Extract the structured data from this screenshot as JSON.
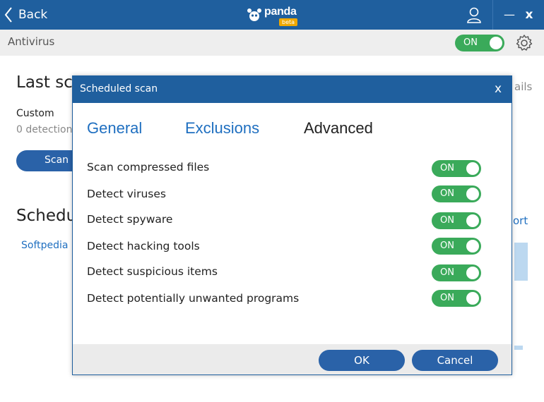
{
  "titlebar": {
    "back_label": "Back",
    "logo_text": "panda",
    "logo_badge": "beta",
    "minimize_label": "—",
    "close_label": "x"
  },
  "antivirus_bar": {
    "title": "Antivirus",
    "toggle_label": "ON"
  },
  "background": {
    "last_scan_title": "Last sca",
    "scan_type": "Custom",
    "detections": "0 detections",
    "scan_button": "Scan n",
    "scheduled_title": "Schedu",
    "schedule_item": "Softpedia",
    "right_partial_1": "ails",
    "right_partial_2": "ort"
  },
  "dialog": {
    "title": "Scheduled scan",
    "close_label": "x",
    "tabs": [
      {
        "label": "General",
        "active": false
      },
      {
        "label": "Exclusions",
        "active": false
      },
      {
        "label": "Advanced",
        "active": true
      }
    ],
    "options": [
      {
        "label": "Scan compressed files",
        "state": "ON"
      },
      {
        "label": "Detect viruses",
        "state": "ON"
      },
      {
        "label": "Detect spyware",
        "state": "ON"
      },
      {
        "label": "Detect hacking tools",
        "state": "ON"
      },
      {
        "label": "Detect suspicious items",
        "state": "ON"
      },
      {
        "label": "Detect potentially unwanted programs",
        "state": "ON"
      }
    ],
    "ok_label": "OK",
    "cancel_label": "Cancel"
  },
  "colors": {
    "brand_blue": "#1f5f9e",
    "button_blue": "#2a62a8",
    "toggle_green": "#3aaa5a",
    "link_blue": "#1f6fc0"
  }
}
